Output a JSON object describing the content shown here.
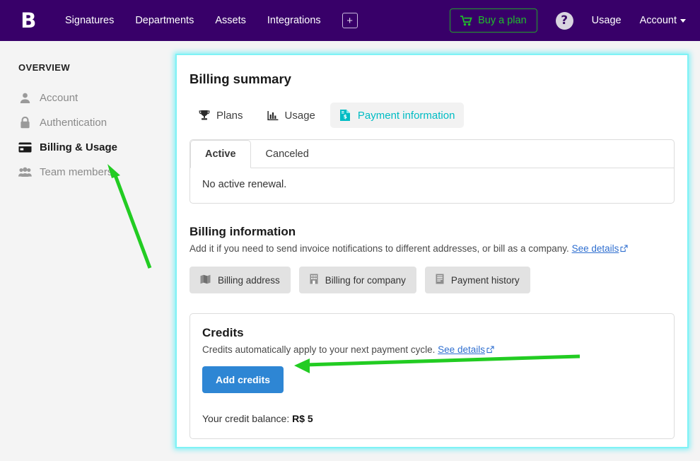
{
  "navbar": {
    "logo": "B",
    "links": [
      {
        "label": "Signatures"
      },
      {
        "label": "Departments"
      },
      {
        "label": "Assets"
      },
      {
        "label": "Integrations"
      }
    ],
    "add_icon": "+",
    "buy_plan_label": "Buy a plan",
    "help_icon": "?",
    "usage_label": "Usage",
    "account_label": "Account",
    "bg_color": "#380069",
    "buy_plan_color": "#1fbe2a"
  },
  "sidebar": {
    "title": "OVERVIEW",
    "items": [
      {
        "label": "Account",
        "icon": "user-icon",
        "active": false
      },
      {
        "label": "Authentication",
        "icon": "lock-icon",
        "active": false
      },
      {
        "label": "Billing & Usage",
        "icon": "credit-card-icon",
        "active": true
      },
      {
        "label": "Team members",
        "icon": "people-icon",
        "active": false
      }
    ]
  },
  "card": {
    "title": "Billing summary",
    "accent_color": "#7ff2f5",
    "tabs": [
      {
        "label": "Plans",
        "icon": "trophy-icon",
        "active": false
      },
      {
        "label": "Usage",
        "icon": "bar-chart-icon",
        "active": false
      },
      {
        "label": "Payment information",
        "icon": "invoice-icon",
        "active": true
      }
    ],
    "renewal_panel": {
      "tabs": [
        {
          "label": "Active",
          "active": true
        },
        {
          "label": "Canceled",
          "active": false
        }
      ],
      "body_text": "No active renewal."
    },
    "billing_information": {
      "title": "Billing information",
      "description": "Add it if you need to send invoice notifications to different addresses, or bill as a company.",
      "link_label": "See details",
      "buttons": [
        {
          "label": "Billing address",
          "icon": "map-icon"
        },
        {
          "label": "Billing for company",
          "icon": "building-icon"
        },
        {
          "label": "Payment history",
          "icon": "receipt-icon"
        }
      ]
    },
    "credits": {
      "title": "Credits",
      "description": "Credits automatically apply to your next payment cycle.",
      "link_label": "See details",
      "add_button_label": "Add credits",
      "balance_label": "Your credit balance:",
      "balance_value": "R$ 5",
      "button_color": "#2e86d4"
    }
  },
  "annotations": {
    "arrow_color": "#22cc22",
    "arrow_1": "points to Billing & Usage sidebar item",
    "arrow_2": "points to Add credits button"
  }
}
